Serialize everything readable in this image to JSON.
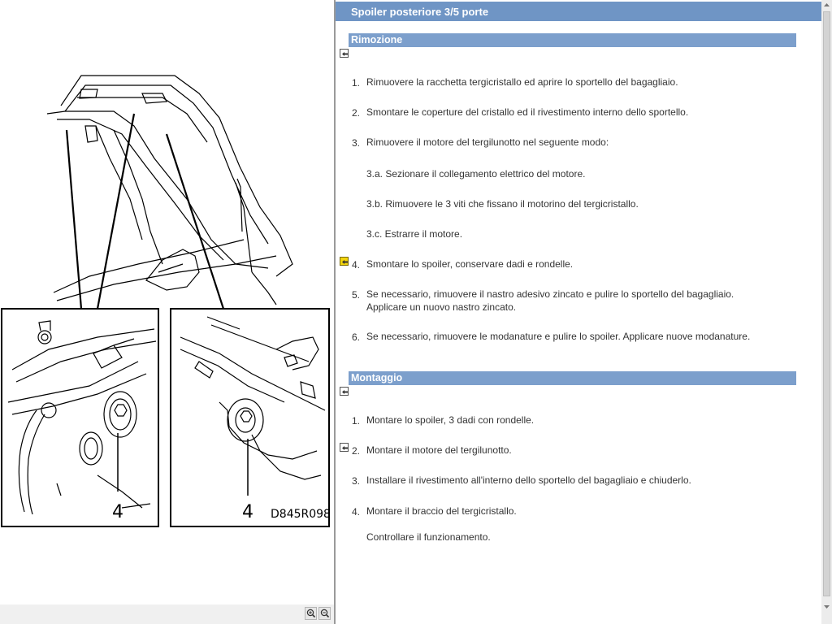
{
  "illustration": {
    "callout_left": "4",
    "callout_right": "4",
    "code": "D845R098"
  },
  "icons": {
    "zoom_in": "zoom-in-icon",
    "zoom_out": "zoom-out-icon",
    "nav_back": "back-arrow-icon",
    "warning": "warning-icon"
  },
  "colors": {
    "title_bar": "#6f95c5",
    "section_bar": "#7c9fcc",
    "text": "#333333"
  },
  "document": {
    "title": "Spoiler posteriore 3/5 porte",
    "removal": {
      "title": "Rimozione",
      "steps": [
        {
          "num": "1.",
          "text": "Rimuovere la racchetta tergicristallo ed aprire lo sportello del bagagliaio."
        },
        {
          "num": "2.",
          "text": "Smontare le coperture del cristallo ed il rivestimento interno dello sportello."
        },
        {
          "num": "3.",
          "text": "Rimuovere il motore del tergilunotto nel seguente modo:"
        },
        {
          "num": "4.",
          "text": "Smontare lo spoiler, conservare dadi e rondelle."
        },
        {
          "num": "5.",
          "text": "Se necessario, rimuovere il nastro adesivo zincato e pulire lo sportello del bagagliaio. Applicare un nuovo nastro zincato."
        },
        {
          "num": "6.",
          "text": "Se necessario, rimuovere le modanature e pulire lo spoiler. Applicare nuove modanature."
        }
      ],
      "substeps": [
        "3.a. Sezionare il collegamento elettrico del motore.",
        "3.b. Rimuovere le 3 viti che fissano il motorino del tergicristallo.",
        "3.c. Estrarre il motore."
      ]
    },
    "installation": {
      "title": "Montaggio",
      "steps": [
        {
          "num": "1.",
          "text": "Montare lo spoiler, 3 dadi con rondelle."
        },
        {
          "num": "2.",
          "text": "Montare il motore del tergilunotto."
        },
        {
          "num": "3.",
          "text": "Installare il rivestimento all'interno dello sportello del bagagliaio e chiuderlo."
        },
        {
          "num": "4.",
          "text": "Montare il braccio del tergicristallo."
        }
      ],
      "note": "Controllare il funzionamento."
    }
  }
}
